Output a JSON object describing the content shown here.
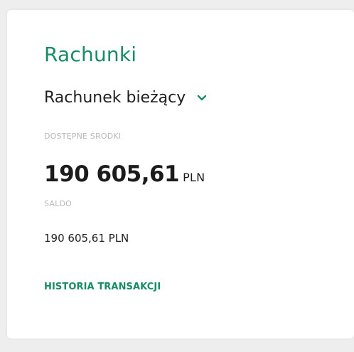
{
  "card": {
    "title": "Rachunki",
    "account_selector": {
      "selected": "Rachunek bieżący",
      "icon": "chevron-down-icon"
    },
    "available_funds": {
      "label": "DOSTĘPNE ŚRODKI",
      "amount": "190 605,61",
      "currency": "PLN"
    },
    "balance": {
      "label": "SALDO",
      "value": "190 605,61 PLN"
    },
    "history_link": "HISTORIA TRANSAKCJI"
  },
  "colors": {
    "accent": "#178c64",
    "text": "#1f1f1f",
    "muted": "#b7b7b7",
    "background": "#eeeeee",
    "card": "#ffffff"
  }
}
